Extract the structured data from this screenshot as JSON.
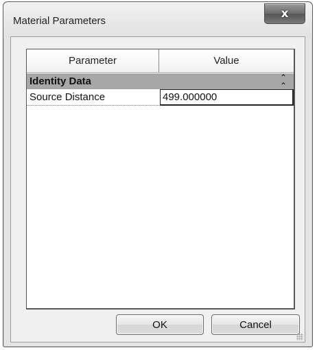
{
  "window": {
    "title": "Material Parameters",
    "close_symbol": "x"
  },
  "grid": {
    "columns": [
      "Parameter",
      "Value"
    ],
    "group": {
      "label": "Identity Data",
      "toggle_icon": "collapse-icon"
    },
    "rows": [
      {
        "parameter": "Source Distance",
        "value": "499.000000"
      }
    ]
  },
  "buttons": {
    "ok_label": "OK",
    "cancel_label": "Cancel"
  }
}
